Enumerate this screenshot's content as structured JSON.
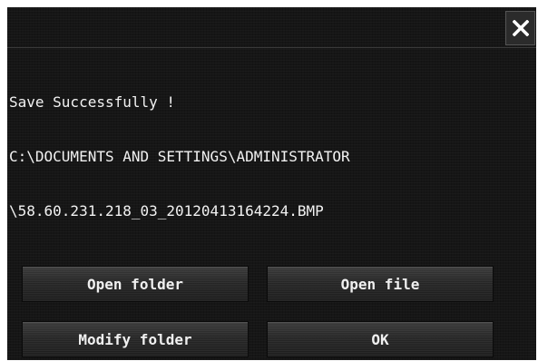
{
  "dialog": {
    "close_icon": "close-icon",
    "message_lines": [
      "Save Successfully !",
      "C:\\DOCUMENTS AND SETTINGS\\ADMINISTRATOR",
      "\\58.60.231.218_03_20120413164224.BMP"
    ],
    "buttons": {
      "open_folder": "Open folder",
      "open_file": "Open file",
      "modify_folder": "Modify folder",
      "ok": "OK"
    }
  }
}
